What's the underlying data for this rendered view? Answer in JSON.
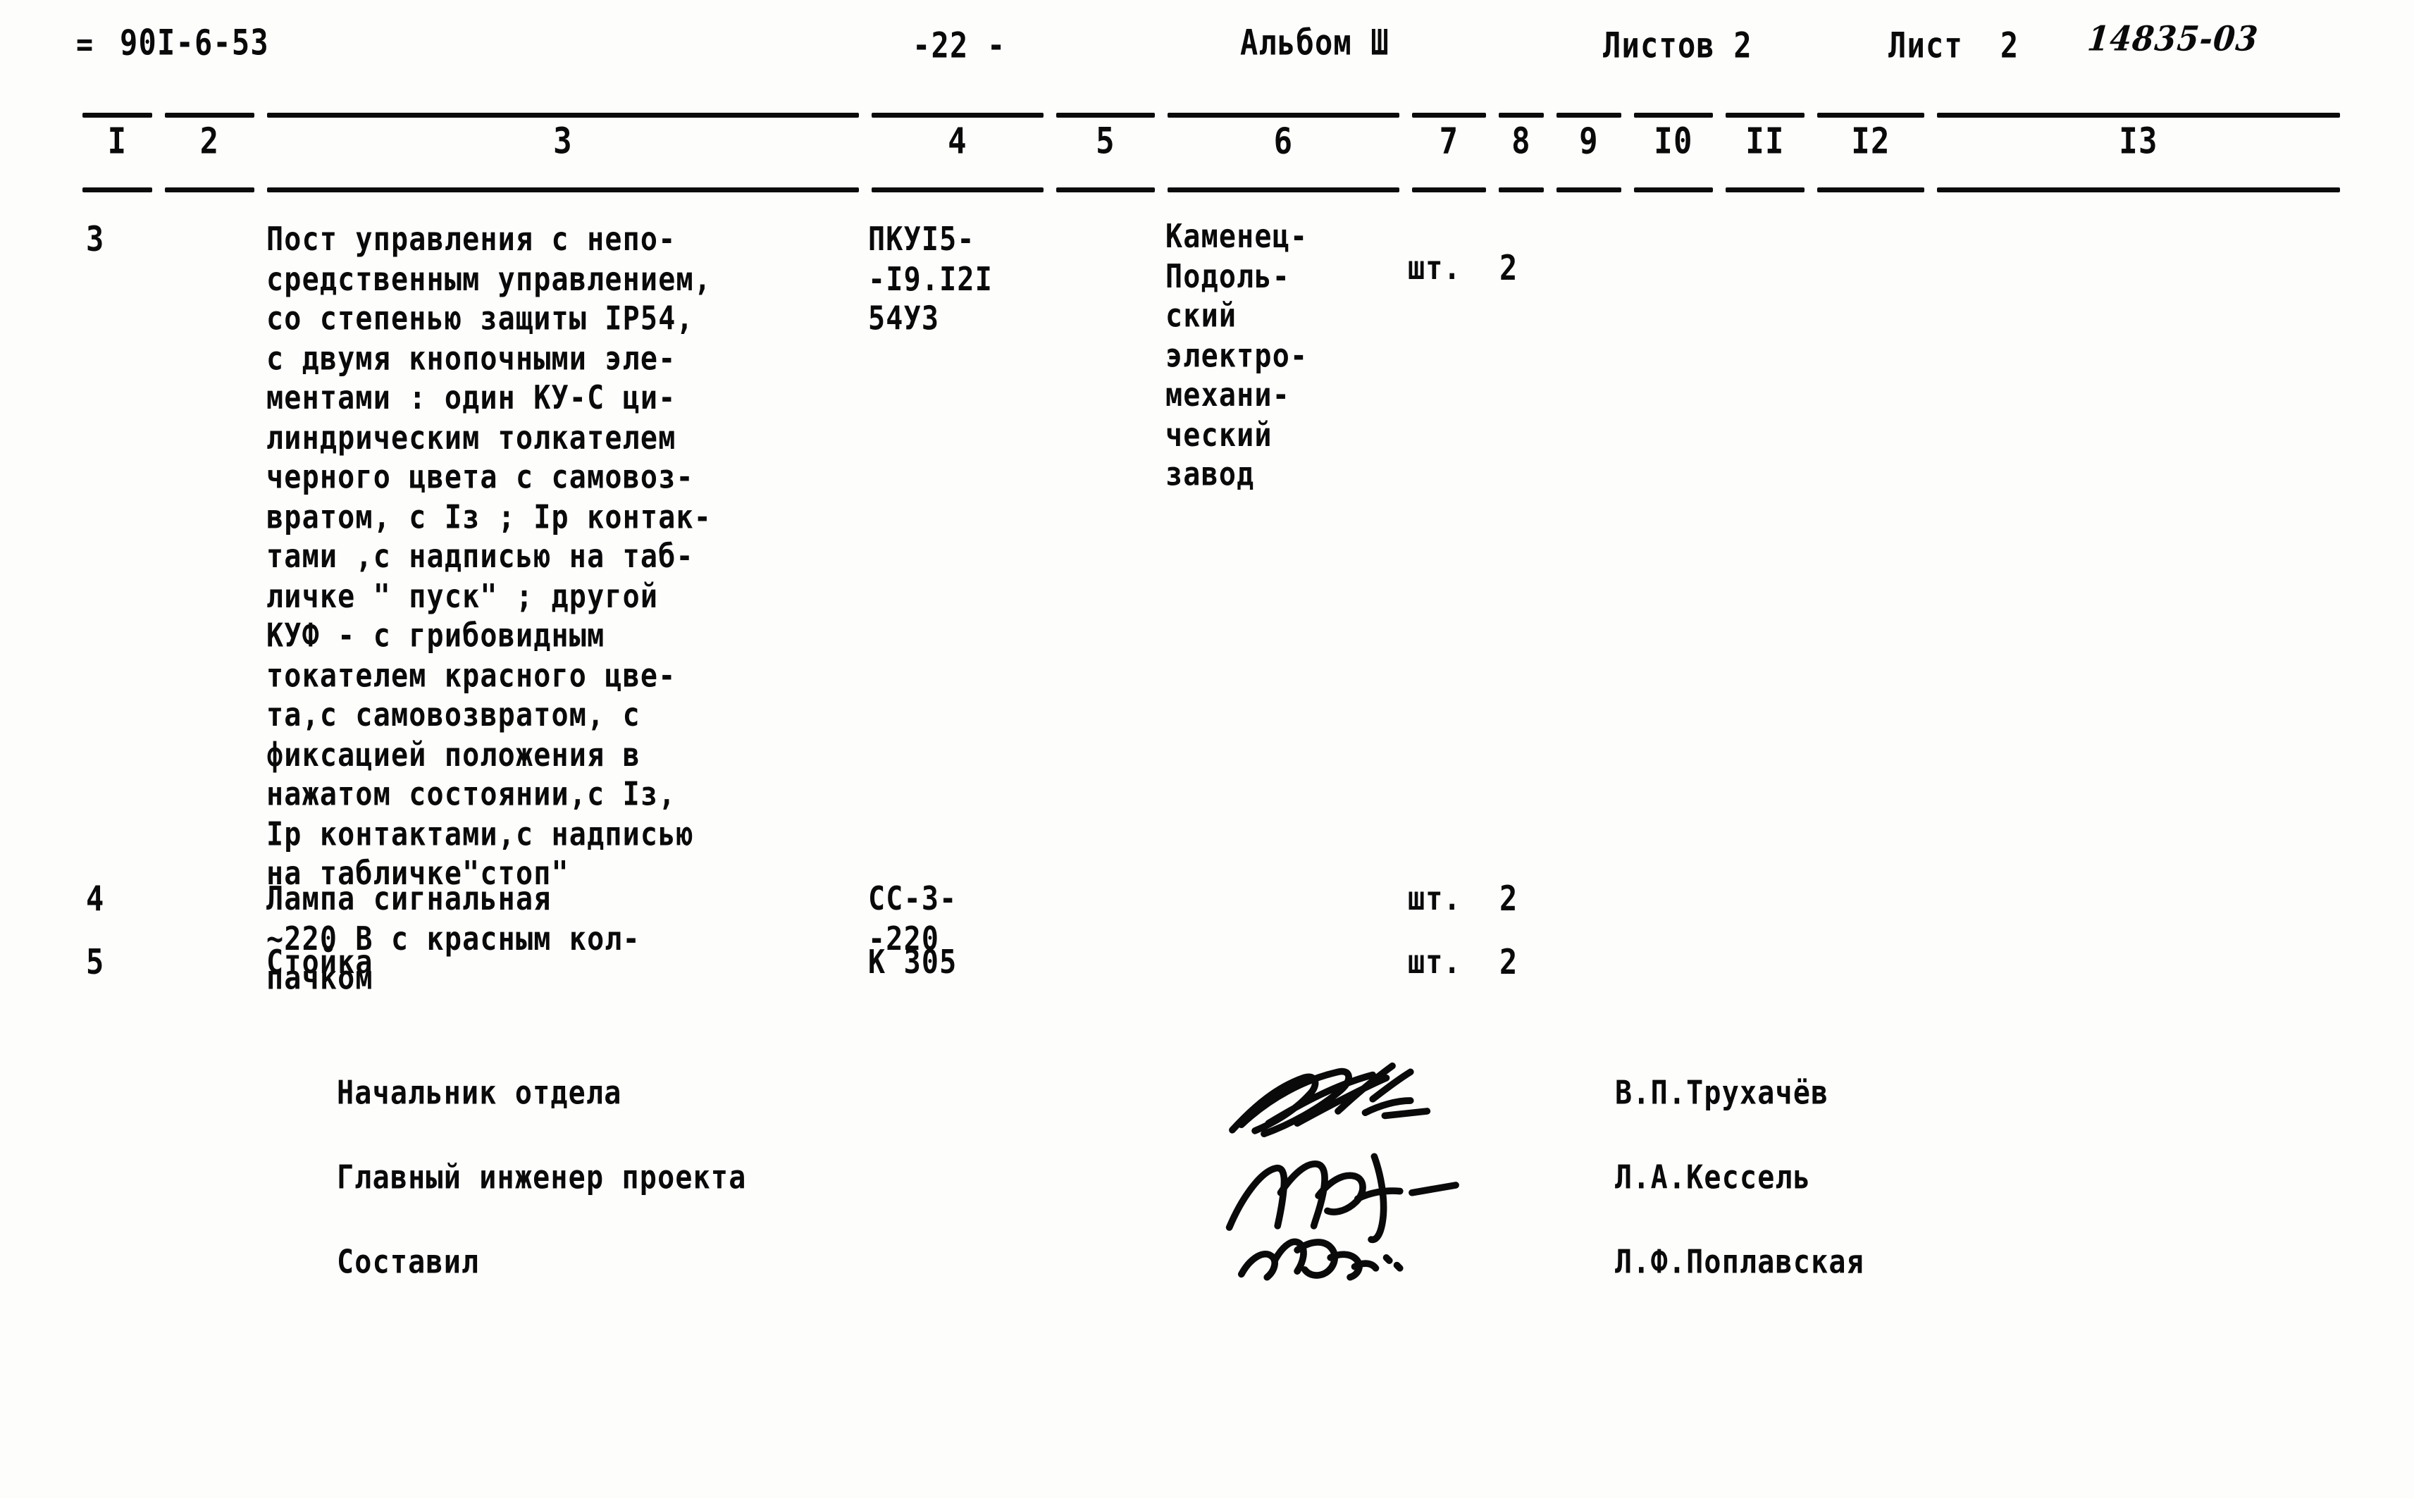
{
  "document": {
    "series_mark": "=",
    "series_code": "90I-6-53",
    "page_number": "-22 -",
    "album_label": "Альбом Ш",
    "sheets_total": "Листов 2",
    "sheet_current": "Лист  2",
    "order_number": "14835-03"
  },
  "table": {
    "column_numbers": [
      "I",
      "2",
      "3",
      "4",
      "5",
      "6",
      "7",
      "8",
      "9",
      "I0",
      "II",
      "I2",
      "I3"
    ],
    "rows": [
      {
        "pos": "3",
        "name": "Пост управления с непо-\nсредственным управлением,\nсо степенью защиты IP54,\nс двумя кнопочными эле-\nментами : один КУ-С ци-\nлиндрическим толкателем\nчерного цвета с самовоз-\nвратом, с Iз ; Iр контак-\nтами ,с надписью на таб-\nличке \" пуск\" ; другой\nКУФ - с грибовидным\nтокателем красного цве-\nта,с самовозвратом, с\nфиксацией положения в\nнажатом состоянии,с Iз,\nIр контактами,с надписью\nна табличке\"стоп\"",
        "type": "ПКУI5-\n-I9.I2I\n54УЗ",
        "maker": "Каменец-\nПодоль-\nский\nэлектро-\nмехани-\nческий\nзавод",
        "unit": "шт.",
        "qty": "2"
      },
      {
        "pos": "4",
        "name": "Лампа сигнальная\n~220 В с красным кол-\nпачком",
        "type": "СС-З-\n-220",
        "maker": "",
        "unit": "шт.",
        "qty": "2"
      },
      {
        "pos": "5",
        "name": "Стойка",
        "type": "К З05",
        "maker": "",
        "unit": "шт.",
        "qty": "2"
      }
    ]
  },
  "signatures": [
    {
      "role": "Начальник отдела",
      "name": "В.П.Трухачёв",
      "mark": "signature-scribble"
    },
    {
      "role": "Главный инженер проекта",
      "name": "Л.А.Кессель",
      "mark": "signature-scribble"
    },
    {
      "role": "Составил",
      "name": "Л.Ф.Поплавская",
      "mark": "signature-scribble"
    }
  ],
  "colors": {
    "ink": "#0a0a0a",
    "paper": "#fdfdfc"
  }
}
